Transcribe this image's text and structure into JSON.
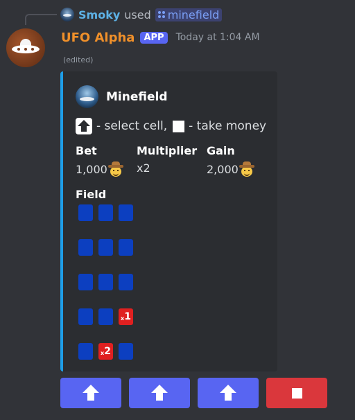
{
  "reply": {
    "username": "Smoky",
    "action": "used",
    "command": "minefield",
    "command_icon": "grid-dots-icon"
  },
  "message": {
    "username": "UFO Alpha",
    "badge": "APP",
    "timestamp": "Today at 1:04 AM",
    "edited": "(edited)",
    "username_color": "#f0902a"
  },
  "embed": {
    "accent_color": "#1e9ee8",
    "author_name": "Minefield",
    "legend": {
      "select_text": "- select cell,",
      "take_text": "- take money"
    },
    "fields": [
      {
        "name": "Bet",
        "value": "1,000",
        "emoji": "cowboy-face-icon"
      },
      {
        "name": "Multiplier",
        "value": "x2",
        "emoji": ""
      },
      {
        "name": "Gain",
        "value": "2,000",
        "emoji": "cowboy-face-icon"
      }
    ],
    "field_title": "Field",
    "grid": [
      [
        {
          "state": "blue"
        },
        {
          "state": "blue"
        },
        {
          "state": "blue"
        }
      ],
      [
        {
          "state": "blue"
        },
        {
          "state": "blue"
        },
        {
          "state": "blue"
        }
      ],
      [
        {
          "state": "blue"
        },
        {
          "state": "blue"
        },
        {
          "state": "blue"
        }
      ],
      [
        {
          "state": "blue"
        },
        {
          "state": "blue"
        },
        {
          "state": "red",
          "prefix": "x",
          "label": "1"
        }
      ],
      [
        {
          "state": "blue"
        },
        {
          "state": "red",
          "prefix": "x",
          "label": "2"
        },
        {
          "state": "blue"
        }
      ]
    ]
  },
  "buttons": [
    {
      "type": "select",
      "icon": "up-arrow-icon",
      "color": "#5865f2"
    },
    {
      "type": "select",
      "icon": "up-arrow-icon",
      "color": "#5865f2"
    },
    {
      "type": "select",
      "icon": "up-arrow-icon",
      "color": "#5865f2"
    },
    {
      "type": "take",
      "icon": "stop-square-icon",
      "color": "#da373c"
    }
  ]
}
